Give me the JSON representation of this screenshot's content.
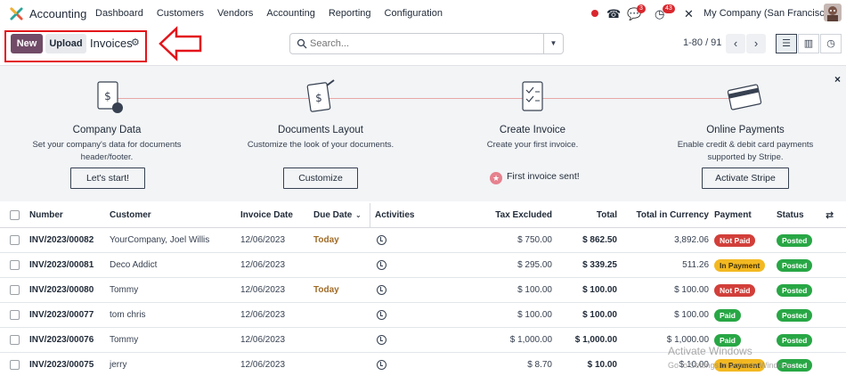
{
  "app": {
    "name": "Accounting"
  },
  "menu": [
    "Dashboard",
    "Customers",
    "Vendors",
    "Accounting",
    "Reporting",
    "Configuration"
  ],
  "systray": {
    "messages_count": "3",
    "activities_count": "43",
    "company": "My Company (San Francisco)"
  },
  "control": {
    "new_label": "New",
    "upload_label": "Upload",
    "breadcrumb": "Invoices",
    "search_placeholder": "Search...",
    "pager": "1-80 / 91"
  },
  "onboarding": {
    "steps": [
      {
        "title": "Company Data",
        "desc1": "Set your company's data for documents",
        "desc2": "header/footer.",
        "button": "Let's start!"
      },
      {
        "title": "Documents Layout",
        "desc1": "Customize the look of your documents.",
        "desc2": "",
        "button": "Customize"
      },
      {
        "title": "Create Invoice",
        "desc1": "Create your first invoice.",
        "desc2": "",
        "done": "First invoice sent!"
      },
      {
        "title": "Online Payments",
        "desc1": "Enable credit & debit card payments",
        "desc2": "supported by Stripe.",
        "button": "Activate Stripe"
      }
    ]
  },
  "table": {
    "columns": [
      "Number",
      "Customer",
      "Invoice Date",
      "Due Date",
      "Activities",
      "Tax Excluded",
      "Total",
      "Total in Currency",
      "Payment",
      "Status"
    ],
    "rows": [
      {
        "number": "INV/2023/00082",
        "customer": "YourCompany, Joel Willis",
        "date": "12/06/2023",
        "due": "Today",
        "tax_excl": "$ 750.00",
        "total": "$ 862.50",
        "total_cur": "3,892.06",
        "payment": "Not Paid",
        "status": "Posted"
      },
      {
        "number": "INV/2023/00081",
        "customer": "Deco Addict",
        "date": "12/06/2023",
        "due": "",
        "tax_excl": "$ 295.00",
        "total": "$ 339.25",
        "total_cur": "511.26",
        "payment": "In Payment",
        "status": "Posted"
      },
      {
        "number": "INV/2023/00080",
        "customer": "Tommy",
        "date": "12/06/2023",
        "due": "Today",
        "tax_excl": "$ 100.00",
        "total": "$ 100.00",
        "total_cur": "$ 100.00",
        "payment": "Not Paid",
        "status": "Posted"
      },
      {
        "number": "INV/2023/00077",
        "customer": "tom chris",
        "date": "12/06/2023",
        "due": "",
        "tax_excl": "$ 100.00",
        "total": "$ 100.00",
        "total_cur": "$ 100.00",
        "payment": "Paid",
        "status": "Posted"
      },
      {
        "number": "INV/2023/00076",
        "customer": "Tommy",
        "date": "12/06/2023",
        "due": "",
        "tax_excl": "$ 1,000.00",
        "total": "$ 1,000.00",
        "total_cur": "$ 1,000.00",
        "payment": "Paid",
        "status": "Posted"
      },
      {
        "number": "INV/2023/00075",
        "customer": "jerry",
        "date": "12/06/2023",
        "due": "",
        "tax_excl": "$ 8.70",
        "total": "$ 10.00",
        "total_cur": "$ 10.00",
        "payment": "In Payment",
        "status": "Posted"
      }
    ]
  },
  "watermark": {
    "title": "Activate Windows",
    "sub": "Go to Settings to activate Windows."
  },
  "colors": {
    "brand": "#714b67",
    "highlight": "#e3141a",
    "notpaid": "#d23f3a",
    "inpayment": "#f3b922",
    "paid": "#28a745"
  }
}
